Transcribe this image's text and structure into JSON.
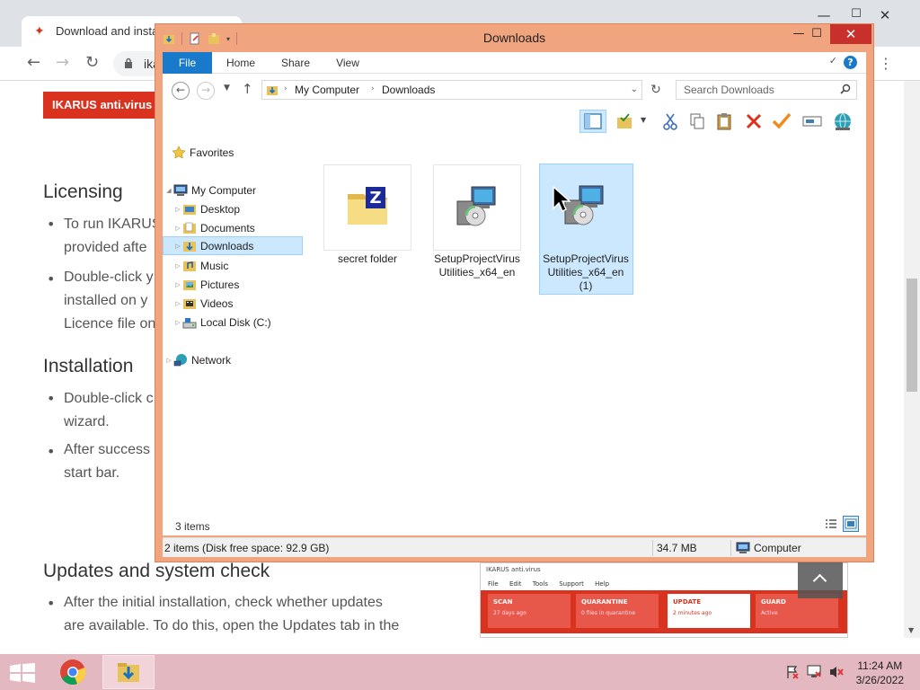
{
  "browser": {
    "tab_title": "Download and install",
    "url_fragment": "ika",
    "minimize": "—",
    "maximize": "☐",
    "close": "✕"
  },
  "page": {
    "product_button": "IKARUS anti.virus Se",
    "licensing_heading": "Licensing",
    "licensing_items": [
      [
        "To run IKARUS",
        "provided afte"
      ],
      [
        "Double-click y",
        "installed on y",
        "Licence file on"
      ]
    ],
    "installation_heading": "Installation",
    "installation_items": [
      [
        "Double-click c",
        "wizard."
      ],
      [
        "After success",
        "start bar."
      ]
    ],
    "updates_heading": "Updates and system check",
    "updates_lines": [
      "After the initial installation, check whether updates",
      "are available. To do this, open the Updates tab in the"
    ],
    "ikarus_app": {
      "title": "IKARUS anti.virus",
      "menu": [
        "File",
        "Edit",
        "Tools",
        "Support",
        "Help"
      ],
      "tiles": [
        {
          "label": "SCAN",
          "sub": "27 days ago"
        },
        {
          "label": "QUARANTINE",
          "sub": "0 files in quarantine"
        },
        {
          "label": "UPDATE",
          "sub": "2 minutes ago"
        },
        {
          "label": "GUARD",
          "sub": "Active"
        }
      ]
    }
  },
  "explorer": {
    "title": "Downloads",
    "ribbon_tabs": [
      "File",
      "Home",
      "Share",
      "View"
    ],
    "path": [
      "My Computer",
      "Downloads"
    ],
    "search_placeholder": "Search Downloads",
    "nav": {
      "favorites": "Favorites",
      "computer": "My Computer",
      "children": [
        "Desktop",
        "Documents",
        "Downloads",
        "Music",
        "Pictures",
        "Videos",
        "Local Disk (C:)"
      ],
      "network": "Network"
    },
    "files": [
      {
        "name": "secret folder"
      },
      {
        "name": "SetupProjectVirus Utilities_x64_en",
        "lines": [
          "SetupProjectVirus",
          "Utilities_x64_en"
        ]
      },
      {
        "name": "SetupProjectVirus Utilities_x64_en (1)",
        "lines": [
          "SetupProjectVirus",
          "Utilities_x64_en",
          "(1)"
        ]
      }
    ],
    "item_count": "3 items",
    "status_left": "2 items (Disk free space: 92.9 GB)",
    "status_size": "34.7 MB",
    "status_location": "Computer"
  },
  "taskbar": {
    "time": "11:24 AM",
    "date": "3/26/2022"
  }
}
